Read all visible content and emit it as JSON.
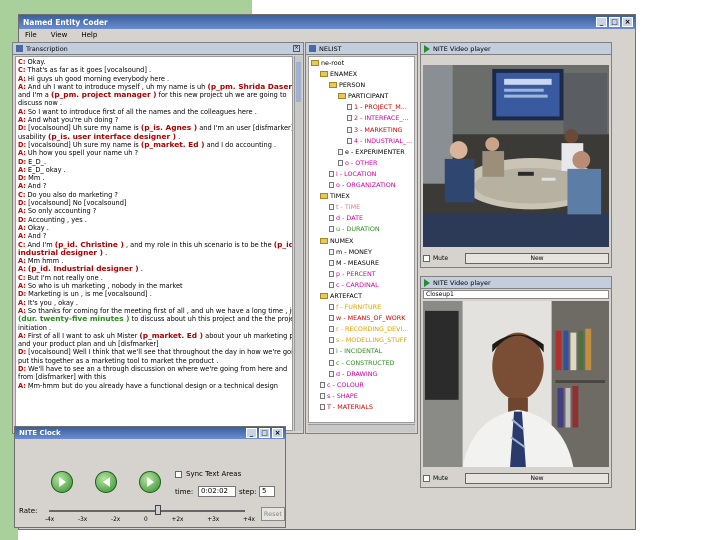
{
  "app": {
    "title": "Named Entity Coder",
    "menu": [
      "File",
      "View",
      "Help"
    ]
  },
  "transcript": {
    "panel_title": "Transcription",
    "lines": [
      {
        "sp": "C:",
        "text": "Okay."
      },
      {
        "sp": "C:",
        "text": "That's as far as it goes [vocalsound] ."
      },
      {
        "sp": "A:",
        "text": "Hi guys uh good morning everybody here ."
      },
      {
        "sp": "A:",
        "text": "And uh I want to introduce myself , uh my name is uh",
        "ne": "(p_pm. Shrida Daseri )"
      },
      {
        "sp": "",
        "text": "and I'm a",
        "ne": "(p_pm. project manager )",
        "after": "for this new project uh we are going to"
      },
      {
        "sp": "",
        "text": "discuss now ."
      },
      {
        "sp": "A:",
        "text": "So I want to introduce first of all the names and the colleagues here ."
      },
      {
        "sp": "A:",
        "text": "And what you're uh doing ?"
      },
      {
        "sp": "D:",
        "text": "[vocalsound] Uh sure my name is",
        "ne": "(p_is. Agnes )",
        "after": "and I'm an user [disfmarker]"
      },
      {
        "sp": "",
        "text": "usability",
        "ne": "(p_is. user interface designer )",
        "after": "."
      },
      {
        "sp": "D:",
        "text": "[vocalsound] Uh sure my name is",
        "ne": "(p_market. Ed )",
        "after": "and I do accounting ."
      },
      {
        "sp": "A:",
        "text": "Uh how you spell your name uh ?"
      },
      {
        "sp": "D:",
        "text": "E_D_."
      },
      {
        "sp": "A:",
        "text": "E_D_ okay ."
      },
      {
        "sp": "D:",
        "text": "Mm ."
      },
      {
        "sp": "A:",
        "text": "And ?"
      },
      {
        "sp": "C:",
        "text": "Do you also do marketing ?"
      },
      {
        "sp": "D:",
        "text": "[vocalsound] No [vocalsound]"
      },
      {
        "sp": "A:",
        "text": "So only accounting ?"
      },
      {
        "sp": "D:",
        "text": "Accounting , yes ."
      },
      {
        "sp": "A:",
        "text": "Okay ."
      },
      {
        "sp": "A:",
        "text": "And ?"
      },
      {
        "sp": "C:",
        "text": "And I'm",
        "ne": "(p_id. Christine )",
        "after": ", and my role in this uh scenario is to be the",
        "ne2": "(p_id."
      },
      {
        "sp": "",
        "text": "",
        "ne": "industrial designer )",
        "after": "."
      },
      {
        "sp": "A:",
        "text": "Mm hmm ."
      },
      {
        "sp": "A:",
        "text": "",
        "ne": "(p_id. Industrial designer )",
        "after": "."
      },
      {
        "sp": "C:",
        "text": "But I'm not really one ."
      },
      {
        "sp": "A:",
        "text": "So who is uh marketing , nobody in the market"
      },
      {
        "sp": "D:",
        "text": "Marketing is un , is me [vocalsound] ."
      },
      {
        "sp": "A:",
        "text": "It's you , okay ."
      },
      {
        "sp": "A:",
        "text": "So thanks for coming for the meeting first of all , and uh we have a long time , just"
      },
      {
        "sp": "",
        "text": "",
        "ne": "(dur. twenty-five minutes )",
        "after": "to discuss about uh this project and the the project",
        "green": true
      },
      {
        "sp": "",
        "text": "initiation ."
      },
      {
        "sp": "A:",
        "text": "First of all I want to ask uh Mister",
        "ne": "(p_market. Ed )",
        "after": "about your uh marketing plan"
      },
      {
        "sp": "",
        "text": "and your product plan and uh [disfmarker]"
      },
      {
        "sp": "D:",
        "text": "[vocalsound] Well I think that we'll see that throughout the day in how we're going to"
      },
      {
        "sp": "",
        "text": "put this together as a marketing tool to market the product ."
      },
      {
        "sp": "D:",
        "text": "We'll have to see an a through discussion on where we're going from here and"
      },
      {
        "sp": "",
        "text": "from [disfmarker] with this"
      },
      {
        "sp": "A:",
        "text": "Mm-hmm but do you already have a functional design or a technical design"
      }
    ]
  },
  "nelist": {
    "panel_title": "NELIST",
    "rows": [
      {
        "d": 0,
        "type": "folder",
        "label": "ne-root",
        "color": "#000000"
      },
      {
        "d": 1,
        "type": "folder",
        "label": "ENAMEX",
        "color": "#000000"
      },
      {
        "d": 2,
        "type": "folder",
        "label": "PERSON",
        "color": "#000000"
      },
      {
        "d": 3,
        "type": "folder",
        "label": "PARTICIPANT",
        "color": "#000000"
      },
      {
        "d": 4,
        "type": "leaf",
        "label": "1 - PROJECT_M...",
        "color": "#d40000"
      },
      {
        "d": 4,
        "type": "leaf",
        "label": "2 - INTERFACE_...",
        "color": "#d000a0"
      },
      {
        "d": 4,
        "type": "leaf",
        "label": "3 - MARKETING",
        "color": "#d40000"
      },
      {
        "d": 4,
        "type": "leaf",
        "label": "4 - INDUSTRIAL_...",
        "color": "#d000a0"
      },
      {
        "d": 3,
        "type": "leaf",
        "label": "e - EXPERIMENTER",
        "color": "#000000"
      },
      {
        "d": 3,
        "type": "leaf",
        "label": "o - OTHER",
        "color": "#d000a0"
      },
      {
        "d": 2,
        "type": "leaf",
        "label": "l - LOCATION",
        "color": "#d000a0"
      },
      {
        "d": 2,
        "type": "leaf",
        "label": "o - ORGANIZATION",
        "color": "#d000a0"
      },
      {
        "d": 1,
        "type": "folder",
        "label": "TIMEX",
        "color": "#000000"
      },
      {
        "d": 2,
        "type": "leaf",
        "label": "t - TIME",
        "color": "#e08080"
      },
      {
        "d": 2,
        "type": "leaf",
        "label": "d - DATE",
        "color": "#d000a0"
      },
      {
        "d": 2,
        "type": "leaf",
        "label": "u - DURATION",
        "color": "#2e8b1e"
      },
      {
        "d": 1,
        "type": "folder",
        "label": "NUMEX",
        "color": "#000000"
      },
      {
        "d": 2,
        "type": "leaf",
        "label": "m - MONEY",
        "color": "#000000"
      },
      {
        "d": 2,
        "type": "leaf",
        "label": "M - MEASURE",
        "color": "#000000"
      },
      {
        "d": 2,
        "type": "leaf",
        "label": "p - PERCENT",
        "color": "#d000a0"
      },
      {
        "d": 2,
        "type": "leaf",
        "label": "c - CARDINAL",
        "color": "#d000a0"
      },
      {
        "d": 1,
        "type": "folder",
        "label": "ARTEFACT",
        "color": "#000000"
      },
      {
        "d": 2,
        "type": "leaf",
        "label": "f - FURNITURE",
        "color": "#e0a000"
      },
      {
        "d": 2,
        "type": "leaf",
        "label": "w - MEANS_OF_WORK",
        "color": "#d40000"
      },
      {
        "d": 2,
        "type": "leaf",
        "label": "r - RECORDING_DEVI...",
        "color": "#e0a000"
      },
      {
        "d": 2,
        "type": "leaf",
        "label": "s - MODELLING_STUFF",
        "color": "#e0a000"
      },
      {
        "d": 2,
        "type": "leaf",
        "label": "i - INCIDENTAL",
        "color": "#2e8b1e"
      },
      {
        "d": 2,
        "type": "leaf",
        "label": "c - CONSTRUCTED",
        "color": "#2e8b1e"
      },
      {
        "d": 2,
        "type": "leaf",
        "label": "d - DRAWING",
        "color": "#d000a0"
      },
      {
        "d": 1,
        "type": "leaf",
        "label": "c - COLOUR",
        "color": "#d000a0"
      },
      {
        "d": 1,
        "type": "leaf",
        "label": "s - SHAPE",
        "color": "#d000a0"
      },
      {
        "d": 1,
        "type": "leaf",
        "label": "T - MATERIALS",
        "color": "#d40000"
      }
    ]
  },
  "video1": {
    "panel_title": "NITE Video player",
    "mute_label": "Mute",
    "new_label": "New"
  },
  "video2": {
    "panel_title": "NITE Video player",
    "select_value": "Closeup1",
    "mute_label": "Mute",
    "new_label": "New"
  },
  "clock": {
    "title": "NITE Clock",
    "sync_label": "Sync Text Areas",
    "time_label": "time:",
    "time_value": "0:02:02",
    "step_label": "step:",
    "step_value": "5",
    "rate_label": "Rate:",
    "rate_ticks": [
      "-4x",
      "-3x",
      "-2x",
      "0",
      "+2x",
      "+3x",
      "+4x"
    ],
    "reset_label": "Reset"
  },
  "colors": {
    "accent": "#3a5f9c",
    "ne_red": "#b00000",
    "ne_green": "#2e8b1e",
    "side_green": "#a9cf9a"
  }
}
